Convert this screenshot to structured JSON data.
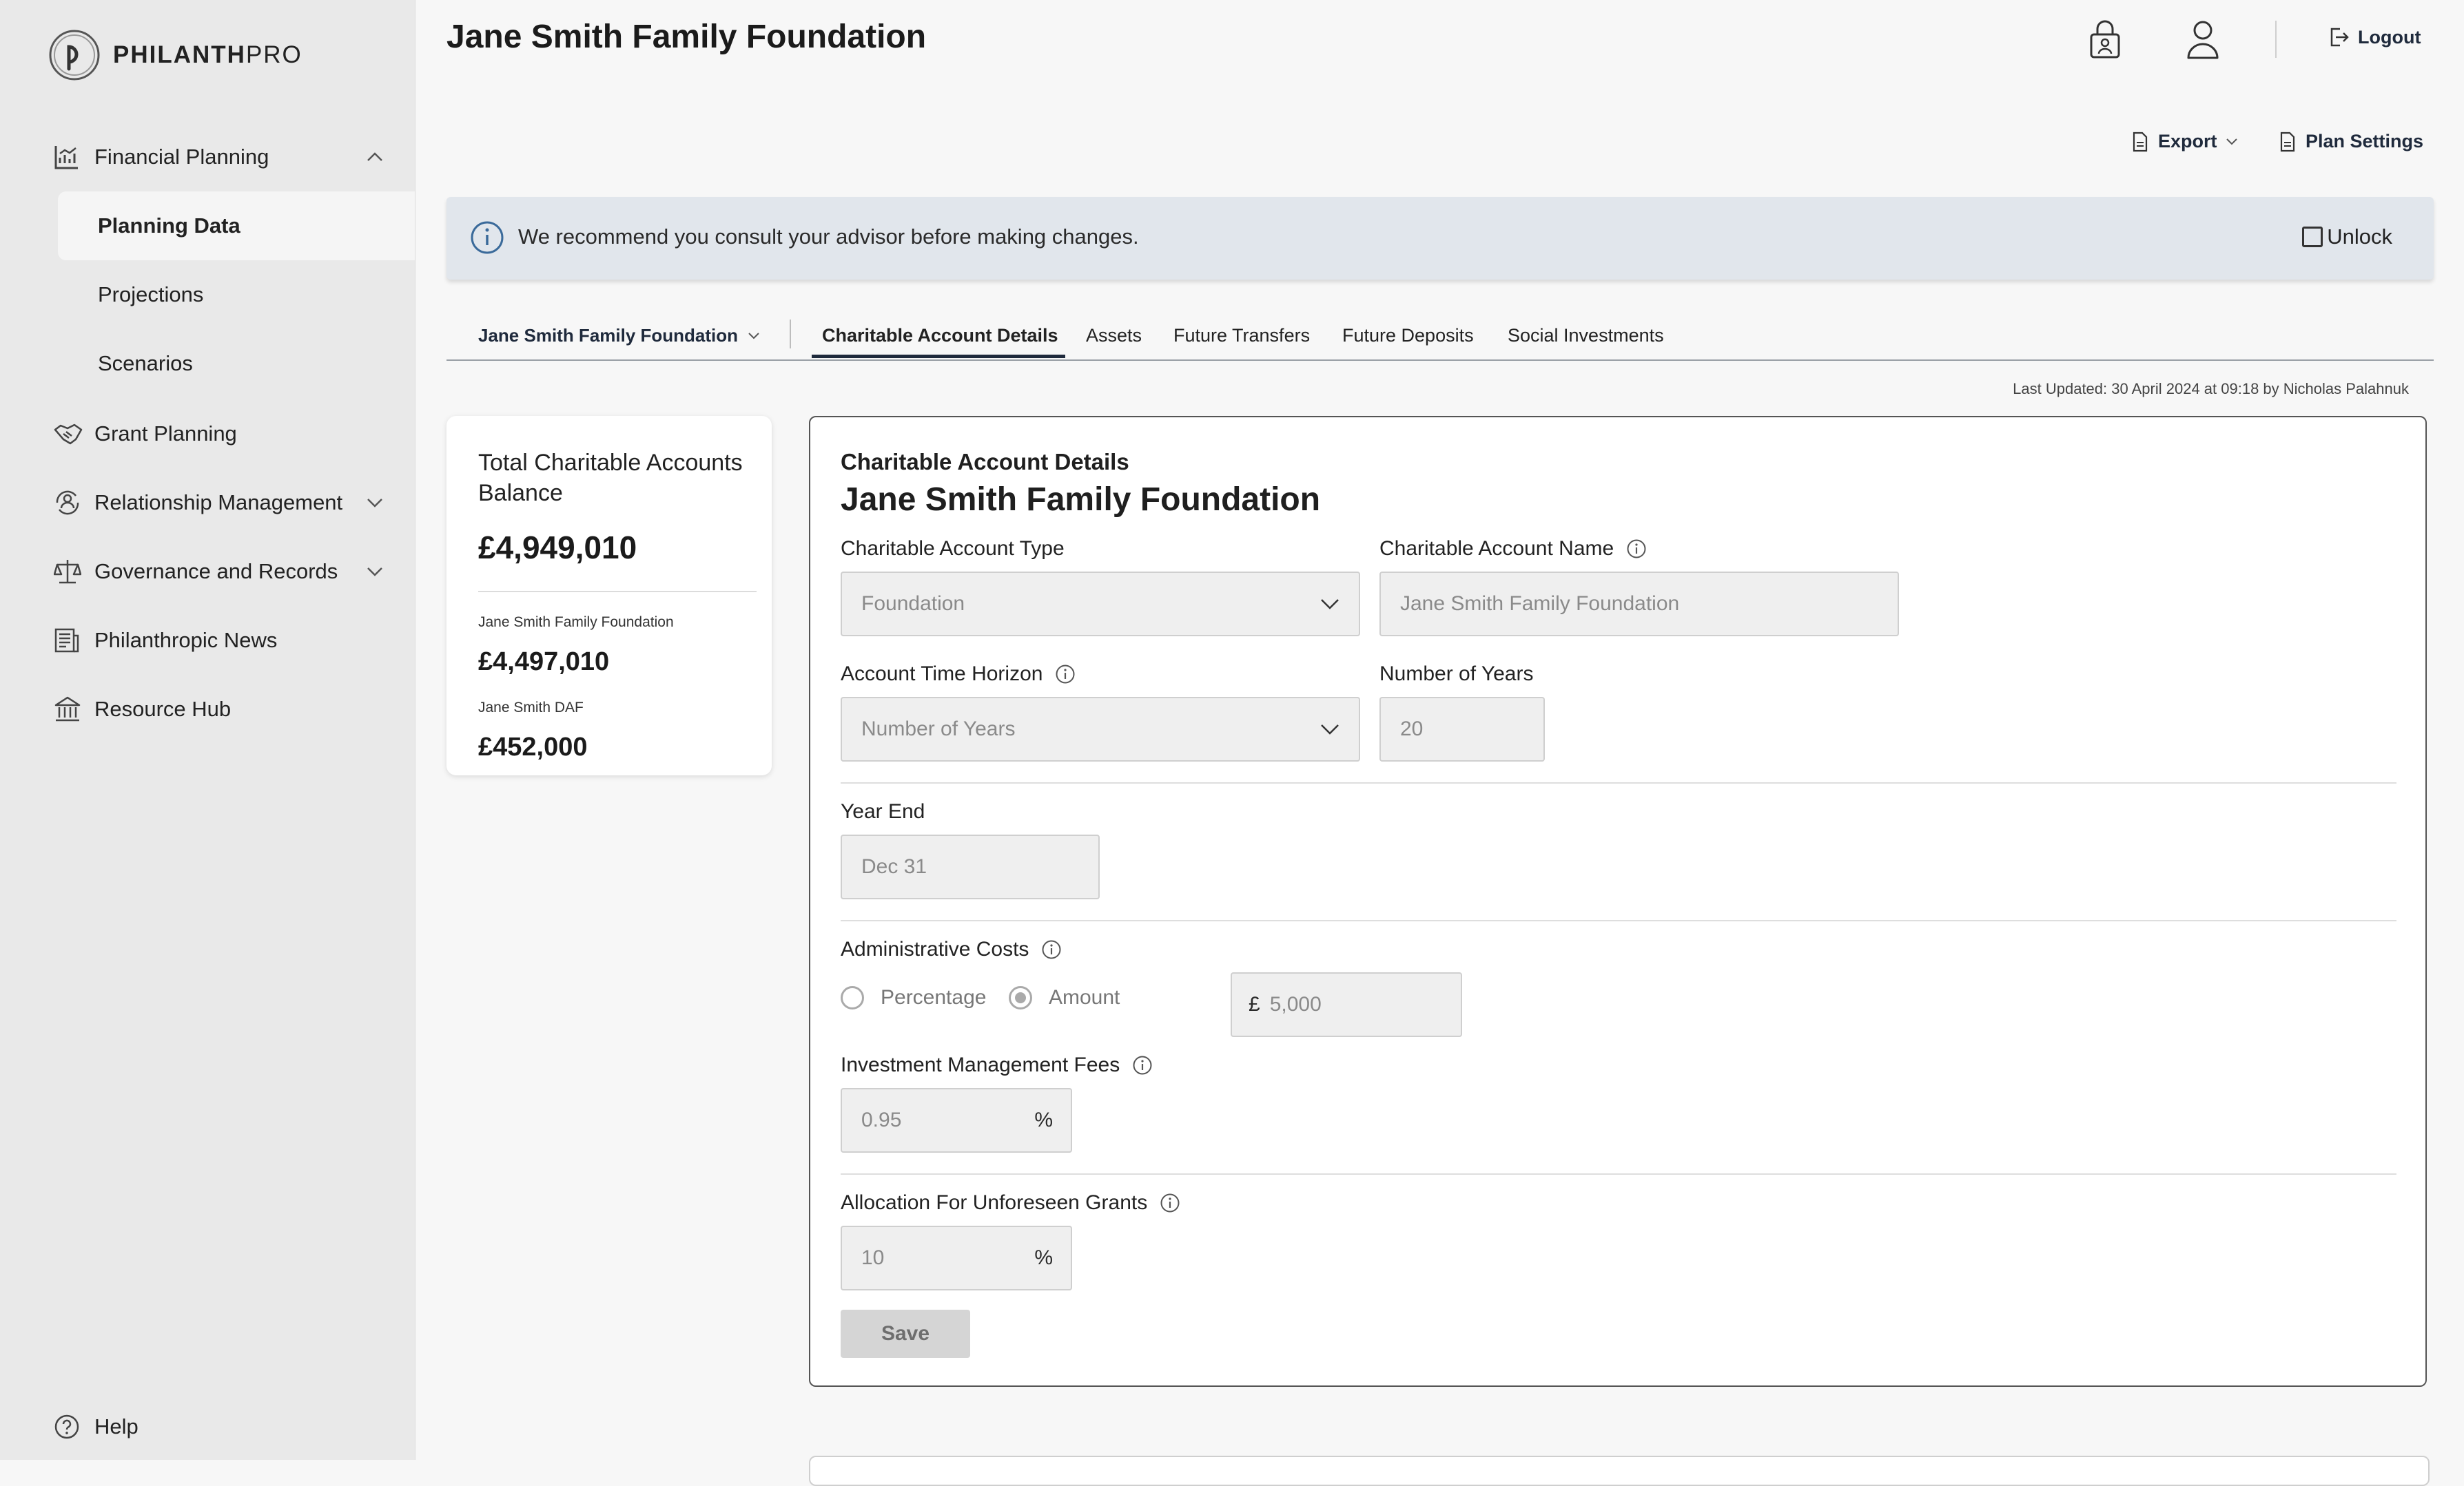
{
  "app": {
    "logo_bold": "PHILANTH",
    "logo_light": "PRO"
  },
  "sidebar": {
    "items": [
      {
        "label": "Financial Planning",
        "icon": "chart-icon",
        "expanded": true
      },
      {
        "label": "Grant Planning",
        "icon": "handshake-icon"
      },
      {
        "label": "Relationship Management",
        "icon": "people-cycle-icon"
      },
      {
        "label": "Governance and Records",
        "icon": "scales-icon"
      },
      {
        "label": "Philanthropic News",
        "icon": "newspaper-icon"
      },
      {
        "label": "Resource Hub",
        "icon": "bank-icon"
      }
    ],
    "sub_items": [
      {
        "label": "Planning Data",
        "active": true
      },
      {
        "label": "Projections"
      },
      {
        "label": "Scenarios"
      }
    ],
    "help": "Help"
  },
  "header": {
    "title": "Jane Smith Family Foundation",
    "logout": "Logout",
    "export": "Export",
    "plan_settings": "Plan Settings"
  },
  "banner": {
    "message": "We recommend you consult your advisor before making changes.",
    "unlock": "Unlock"
  },
  "tabs": {
    "account_selector": "Jane Smith Family Foundation",
    "items": [
      {
        "label": "Charitable Account Details",
        "active": true
      },
      {
        "label": "Assets"
      },
      {
        "label": "Future Transfers"
      },
      {
        "label": "Future Deposits"
      },
      {
        "label": "Social Investments"
      }
    ],
    "last_updated": "Last Updated: 30 April 2024 at 09:18 by Nicholas Palahnuk"
  },
  "balance": {
    "title": "Total Charitable Accounts Balance",
    "total": "£4,949,010",
    "accounts": [
      {
        "name": "Jane Smith Family Foundation",
        "amount": "£4,497,010"
      },
      {
        "name": "Jane Smith DAF",
        "amount": "£452,000"
      }
    ]
  },
  "form": {
    "subtitle": "Charitable Account Details",
    "title": "Jane Smith Family Foundation",
    "account_type": {
      "label": "Charitable Account Type",
      "value": "Foundation"
    },
    "account_name": {
      "label": "Charitable Account Name",
      "value": "Jane Smith Family Foundation"
    },
    "time_horizon": {
      "label": "Account Time Horizon",
      "value": "Number of Years"
    },
    "num_years": {
      "label": "Number of Years",
      "value": "20"
    },
    "year_end": {
      "label": "Year End",
      "value": "Dec 31"
    },
    "admin_costs": {
      "label": "Administrative Costs",
      "option_percentage": "Percentage",
      "option_amount": "Amount",
      "selected": "Amount",
      "currency": "£",
      "value": "5,000"
    },
    "mgmt_fees": {
      "label": "Investment Management Fees",
      "value": "0.95",
      "suffix": "%"
    },
    "unforeseen": {
      "label": "Allocation For Unforeseen Grants",
      "value": "10",
      "suffix": "%"
    },
    "save": "Save"
  }
}
